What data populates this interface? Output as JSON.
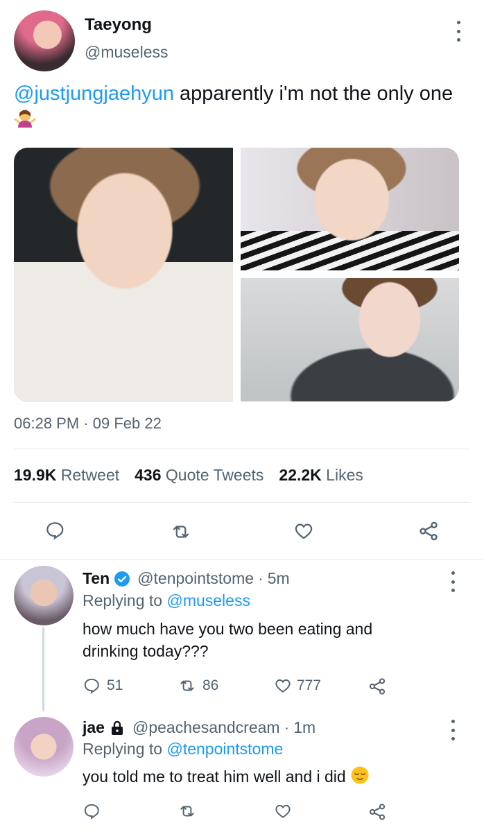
{
  "main_tweet": {
    "display_name": "Taeyong",
    "handle": "@museless",
    "mention": "@justjungjaehyun",
    "text": " apparently i'm not the only one",
    "timestamp": "06:28 PM",
    "date": "09 Feb 22",
    "stats": {
      "retweets": "19.9K",
      "retweets_label": "Retweet",
      "quotes": "436",
      "quotes_label": "Quote Tweets",
      "likes": "22.2K",
      "likes_label": "Likes"
    }
  },
  "replies": [
    {
      "display_name": "Ten",
      "verified": true,
      "handle": "@tenpointstome",
      "time": "5m",
      "replying_prefix": "Replying to",
      "replying_to": "@museless",
      "text": "how much have you two been eating and drinking today???",
      "counts": {
        "replies": "51",
        "retweets": "86",
        "likes": "777"
      }
    },
    {
      "display_name": "jae",
      "protected": true,
      "handle": "@peachesandcream",
      "time": "1m",
      "replying_prefix": "Replying to",
      "replying_to": "@tenpointstome",
      "text": "you told me to treat him well and i did"
    }
  ],
  "colors": {
    "accent": "#1d9bf0",
    "text_primary": "#0f1419",
    "text_secondary": "#536471",
    "divider": "#e4e8eb"
  },
  "icons": [
    "reply-icon",
    "retweet-icon",
    "like-icon",
    "share-icon",
    "more-icon",
    "verified-badge-icon",
    "lock-icon"
  ]
}
